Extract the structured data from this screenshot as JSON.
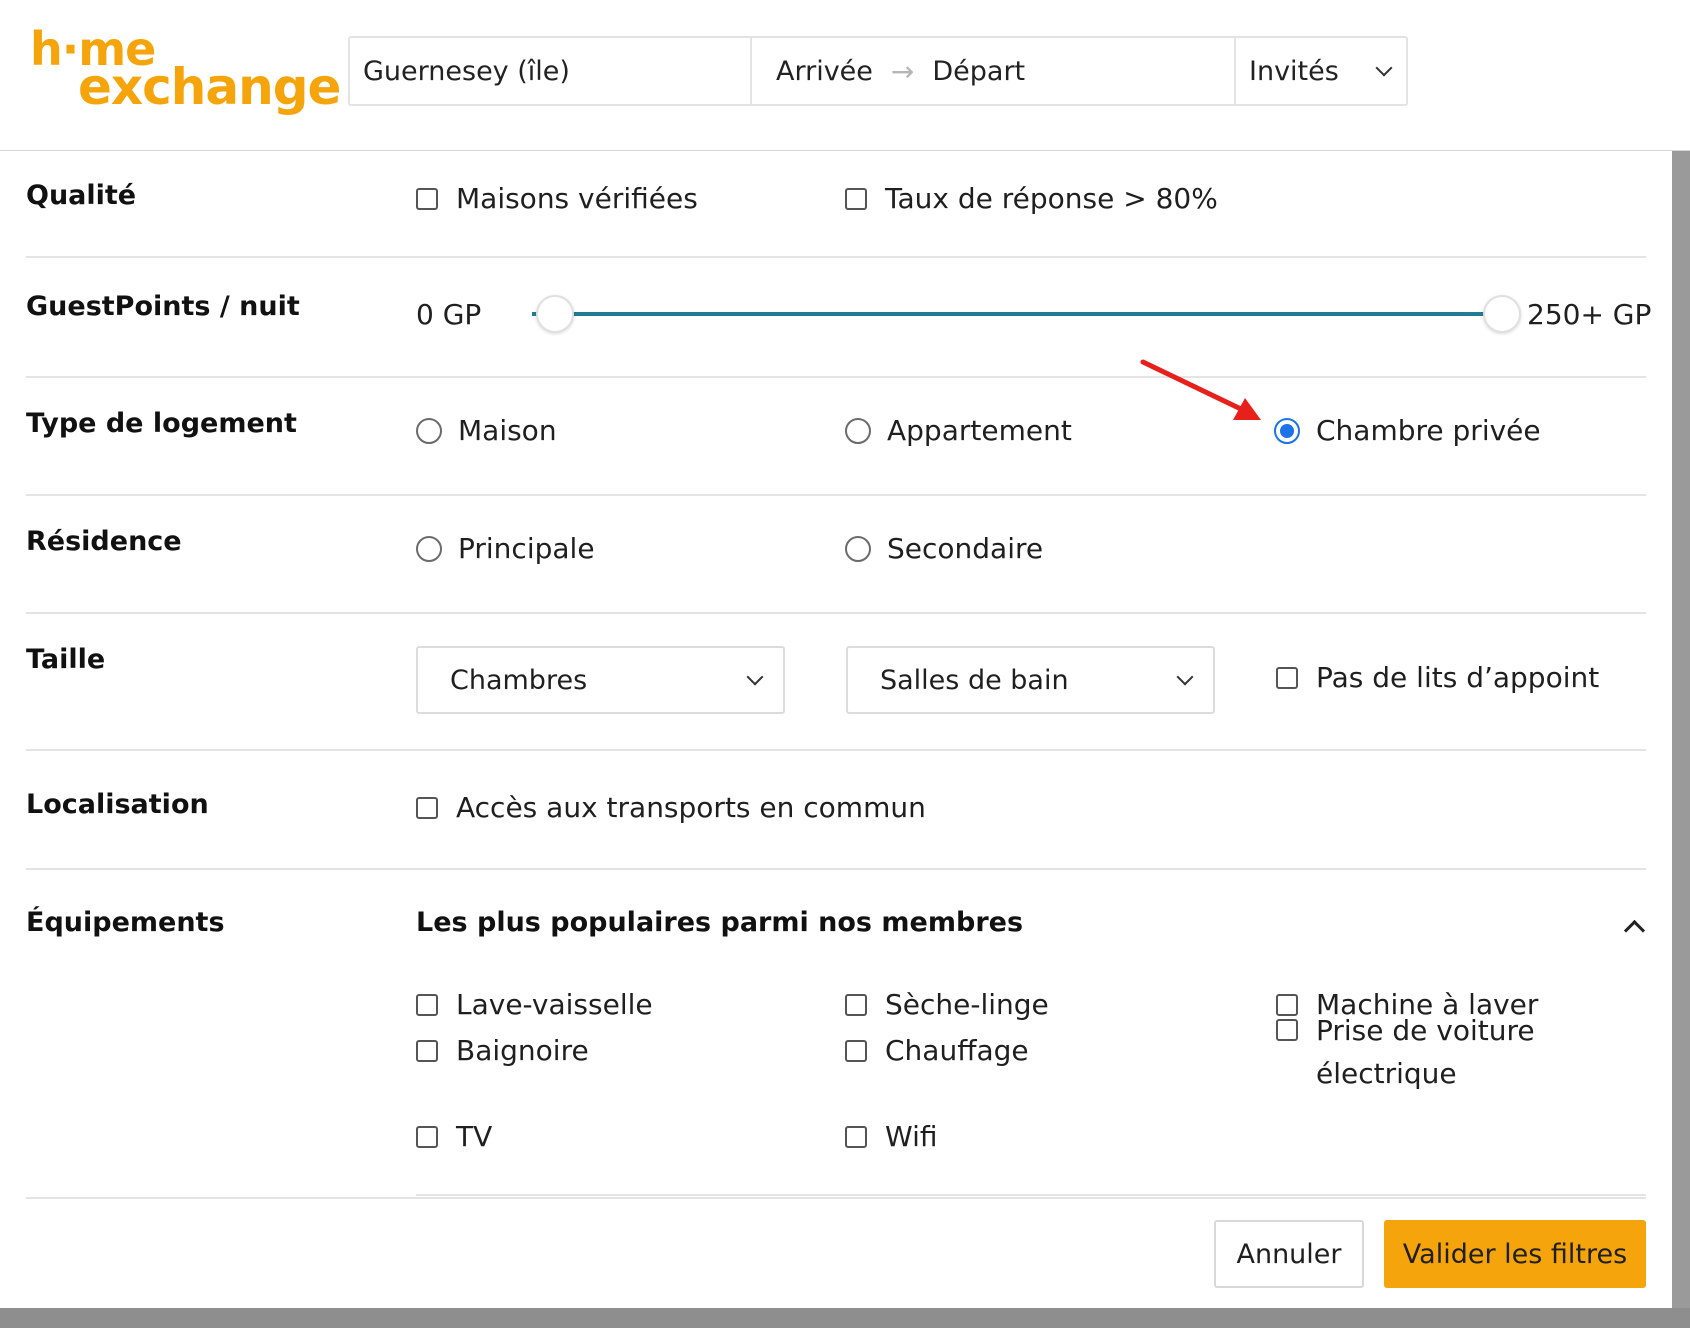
{
  "header": {
    "logo_line1": "h·me",
    "logo_line2": "exchange",
    "destination": "Guernesey (île)",
    "arrival": "Arrivée",
    "date_arrow": "→",
    "departure": "Départ",
    "guests": "Invités"
  },
  "quality": {
    "label": "Qualité",
    "verified": "Maisons vérifiées",
    "response_rate": "Taux de réponse > 80%"
  },
  "guestpoints": {
    "label": "GuestPoints / nuit",
    "min": "0 GP",
    "max": "250+ GP"
  },
  "housing": {
    "label": "Type de logement",
    "house": "Maison",
    "apartment": "Appartement",
    "private_room": "Chambre privée",
    "selected": "Chambre privée"
  },
  "residence": {
    "label": "Résidence",
    "primary": "Principale",
    "secondary": "Secondaire"
  },
  "size": {
    "label": "Taille",
    "bedrooms": "Chambres",
    "bathrooms": "Salles de bain",
    "no_extra_beds": "Pas de lits d’appoint"
  },
  "location": {
    "label": "Localisation",
    "transport": "Accès aux transports en commun"
  },
  "equipment": {
    "label": "Équipements",
    "popular_title": "Les plus populaires parmi nos membres",
    "items": {
      "dishwasher": "Lave-vaisselle",
      "dryer": "Sèche-linge",
      "washing_machine": "Machine à laver",
      "bathtub": "Baignoire",
      "heating": "Chauffage",
      "ev_charger": "Prise de voiture électrique",
      "tv": "TV",
      "wifi": "Wifi"
    }
  },
  "footer": {
    "cancel": "Annuler",
    "apply": "Valider les filtres"
  },
  "colors": {
    "brand": "#f5a50b",
    "slider": "#217c91",
    "radio_selected": "#1a73e8",
    "annotation": "#e8201c"
  }
}
